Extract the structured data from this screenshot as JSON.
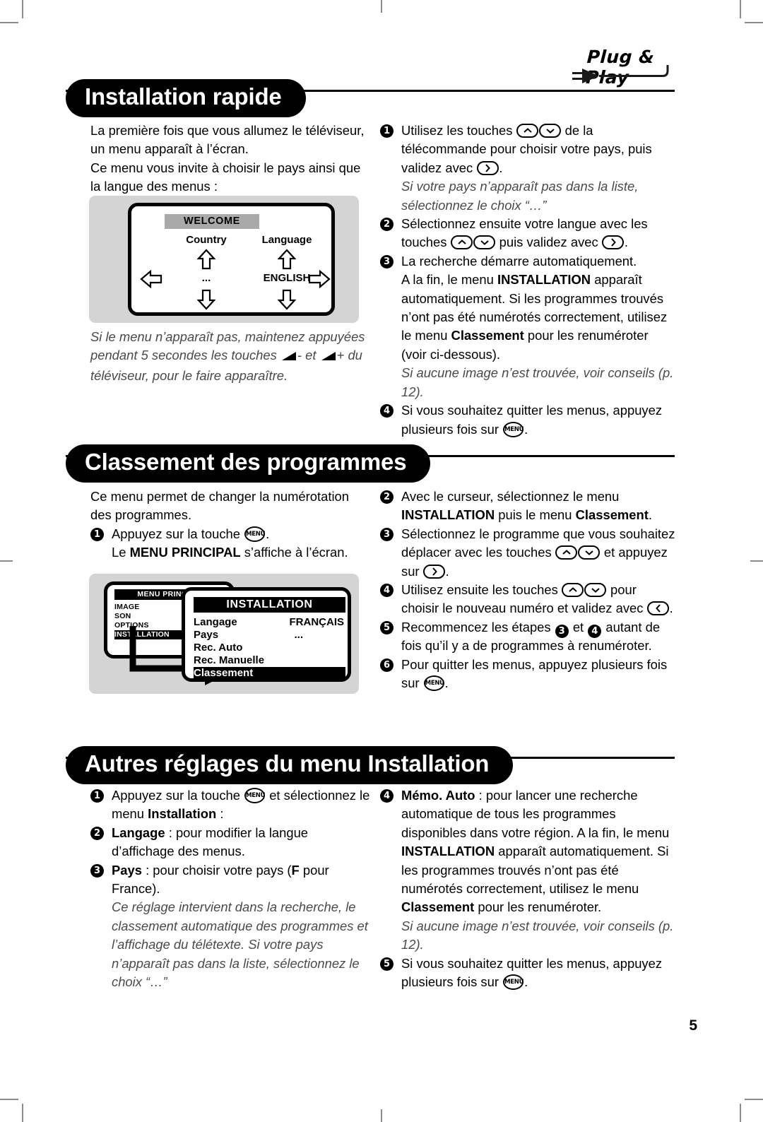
{
  "page": {
    "number": "5"
  },
  "logo": {
    "text": "Plug & Play",
    "icon": "power-plug-icon"
  },
  "sections": [
    {
      "id": "installation-rapide",
      "title": "Installation rapide",
      "intro": [
        "La première fois que vous allumez le téléviseur, un menu apparaît à l’écran.",
        "Ce menu vous invite à choisir le pays ainsi que la langue des menus :"
      ],
      "note": "Si le menu n’apparaît pas, maintenez appuyées pendant 5 secondes les touches ",
      "note_mid": "- et ",
      "note_end": "+ du téléviseur, pour le faire apparaître.",
      "steps": [
        {
          "n": "1",
          "pre": "Utilisez les touches ",
          "mid": " de la télécommande pour choisir votre pays, puis validez avec ",
          "post": ".",
          "italic": "Si votre pays n’apparaît pas dans la liste, sélectionnez le choix “…”"
        },
        {
          "n": "2",
          "pre": "Sélectionnez ensuite votre langue avec les touches ",
          "mid": " puis validez avec ",
          "post": "."
        },
        {
          "n": "3",
          "l1": "La recherche démarre automatiquement.",
          "l2a": "A la fin, le menu ",
          "l2b": "INSTALLATION",
          "l2c": " apparaît automatiquement. Si les programmes trouvés n’ont pas été numérotés correctement, utilisez le menu ",
          "l2d": "Classement",
          "l2e": " pour les renuméroter (voir ci-dessous).",
          "italic": "Si aucune image n’est trouvée, voir conseils (p. 12)."
        },
        {
          "n": "4",
          "pre": "Si vous souhaitez quitter les menus, appuyez plusieurs fois sur ",
          "post": "."
        }
      ]
    },
    {
      "id": "classement-des-programmes",
      "title": "Classement des programmes",
      "intro": "Ce menu permet de changer la numérotation des programmes.",
      "steps_left": [
        {
          "n": "1",
          "pre": "Appuyez sur la touche ",
          "post": ".",
          "l2a": "Le ",
          "l2b": "MENU PRINCIPAL",
          "l2c": " s’affiche à l’écran."
        }
      ],
      "steps_right": [
        {
          "n": "2",
          "pre": "Avec le curseur, sélectionnez le menu ",
          "b1": "INSTALLATION",
          "mid": " puis le menu ",
          "b2": "Classement",
          "post": "."
        },
        {
          "n": "3",
          "pre": "Sélectionnez le programme que vous souhaitez déplacer avec les touches ",
          "mid": " et appuyez sur ",
          "post": "."
        },
        {
          "n": "4",
          "pre": "Utilisez ensuite les touches ",
          "mid": " pour choisir le nouveau numéro et validez avec ",
          "post": "."
        },
        {
          "n": "5",
          "pre": "Recommencez les étapes ",
          "s1": "3",
          "mid": " et ",
          "s2": "4",
          "post": " autant de fois qu’il y a de programmes à renuméroter."
        },
        {
          "n": "6",
          "pre": "Pour quitter les menus, appuyez plusieurs fois sur ",
          "post": "."
        }
      ]
    },
    {
      "id": "autres-reglages",
      "title": "Autres réglages du menu Installation",
      "steps_left": [
        {
          "n": "1",
          "pre": "Appuyez sur la touche ",
          "mid": " et sélectionnez le menu ",
          "b1": "Installation",
          "post": " :"
        },
        {
          "n": "2",
          "b1": "Langage",
          "post": " : pour modifier la langue d’affichage des menus."
        },
        {
          "n": "3",
          "b1": "Pays",
          "post1": " : pour choisir votre pays (",
          "b2": "F",
          "post2": " pour France).",
          "italic": "Ce réglage intervient dans la recherche, le classement automatique des programmes et l’affichage du télétexte. Si votre pays n’apparaît pas dans la liste, sélectionnez le choix “…”"
        }
      ],
      "steps_right": [
        {
          "n": "4",
          "b1": "Mémo. Auto",
          "p1": " : pour lancer une recherche automatique de tous les programmes disponibles dans votre région. A la fin, le menu ",
          "b2": "INSTALLATION",
          "p2": " apparaît automatiquement. Si les programmes trouvés n’ont pas été numérotés correctement, utilisez le menu ",
          "b3": "Classement",
          "p3": " pour les renuméroter.",
          "italic": "Si aucune image n’est trouvée, voir conseils (p. 12)."
        },
        {
          "n": "5",
          "pre": "Si vous souhaitez quitter les menus, appuyez plusieurs fois sur ",
          "post": "."
        }
      ]
    }
  ],
  "diagram_welcome": {
    "title": "WELCOME",
    "col1_label": "Country",
    "col1_value": "...",
    "col2_label": "Language",
    "col2_value": "ENGLISH"
  },
  "diagram_menu": {
    "main_title": "MENU PRINCIPAL",
    "main_items": [
      "IMAGE",
      "SON",
      "OPTIONS",
      "INSTALLATION"
    ],
    "main_selected": "INSTALLATION",
    "install_title": "INSTALLATION",
    "install_rows": [
      {
        "label": "Langage",
        "value": "FRANÇAIS",
        "selected": false
      },
      {
        "label": "Pays",
        "value": "...",
        "selected": false
      },
      {
        "label": "Rec. Auto",
        "value": "",
        "selected": false
      },
      {
        "label": "Rec. Manuelle",
        "value": "",
        "selected": false
      },
      {
        "label": "Classement",
        "value": "",
        "selected": true
      }
    ]
  },
  "colors": {
    "banner_bg": "#000000",
    "banner_text": "#ffffff",
    "diagram_bg": "#d4d4d4",
    "note_text": "#4a4a4a"
  }
}
